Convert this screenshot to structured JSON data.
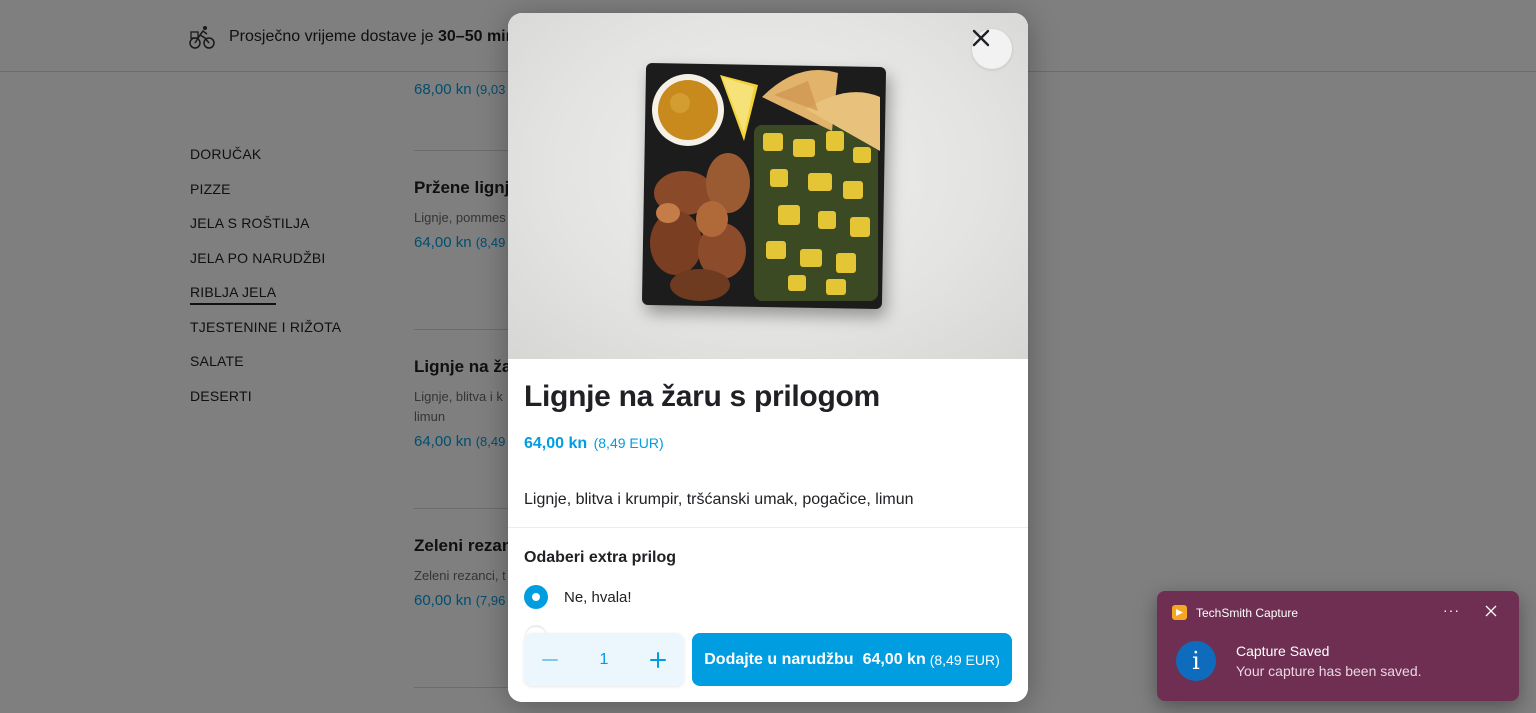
{
  "header": {
    "delivery_prefix": "Prosječno vrijeme dostave je",
    "delivery_time": "30–50 min"
  },
  "categories": [
    {
      "label": "DORUČAK"
    },
    {
      "label": "PIZZE"
    },
    {
      "label": "JELA S ROŠTILJA"
    },
    {
      "label": "JELA PO NARUDŽBI"
    },
    {
      "label": "RIBLJA JELA",
      "active": true
    },
    {
      "label": "TJESTENINE I RIŽOTA"
    },
    {
      "label": "SALATE"
    },
    {
      "label": "DESERTI"
    }
  ],
  "menu_items": [
    {
      "name": "",
      "description": "",
      "price": "68,00 kn",
      "price_eur": "(9,03"
    },
    {
      "name": "Pržene lignj",
      "description": "Lignje, pommes",
      "price": "64,00 kn",
      "price_eur": "(8,49"
    },
    {
      "name": "Lignje na ža",
      "description": "Lignje, blitva i k limun",
      "price": "64,00 kn",
      "price_eur": "(8,49"
    },
    {
      "name": "Zeleni rezan",
      "description": "Zeleni rezanci, t",
      "price": "60,00 kn",
      "price_eur": "(7,96"
    }
  ],
  "modal": {
    "title": "Lignje na žaru s prilogom",
    "price": "64,00 kn",
    "price_eur": "(8,49 EUR)",
    "description": "Lignje, blitva i krumpir, tršćanski umak, pogačice, limun",
    "extra_title": "Odaberi extra prilog",
    "option_selected": "Ne, hvala!",
    "quantity": "1",
    "add_label": "Dodajte u narudžbu",
    "add_price": "64,00 kn",
    "add_price_eur": "(8,49 EUR)",
    "icons": {
      "close": "close-icon",
      "minus": "minus-icon",
      "plus": "plus-icon",
      "radio": "radio-selected-icon"
    }
  },
  "toast": {
    "app_name": "TechSmith Capture",
    "more": "···",
    "title": "Capture Saved",
    "message": "Your capture has been saved.",
    "info_glyph": "i"
  },
  "colors": {
    "accent": "#009de0",
    "toast_bg": "#6e2f52",
    "overlay": "rgba(0,0,0,0.5)"
  }
}
